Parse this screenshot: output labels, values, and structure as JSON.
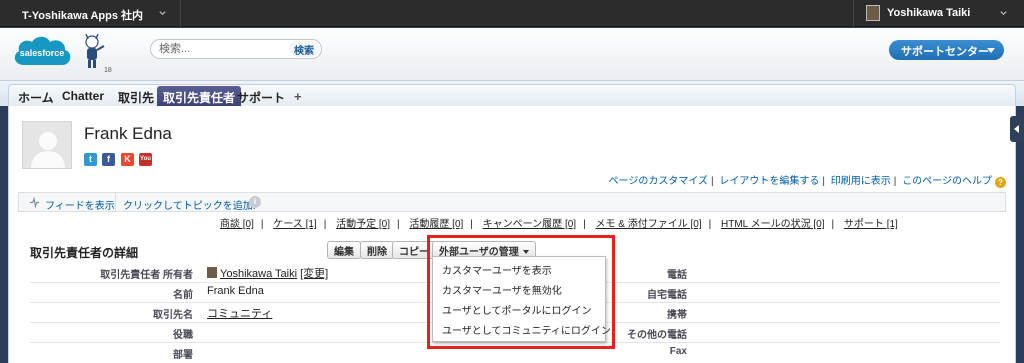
{
  "topbar": {
    "app_name": "T-Yoshikawa Apps 社内",
    "user_name": "Yoshikawa Taiki"
  },
  "header": {
    "logo_text": "salesforce",
    "mascot_badge": "18",
    "search_placeholder": "検索...",
    "search_button": "検索",
    "support_button": "サポートセンター"
  },
  "tabs": [
    {
      "label": "ホーム"
    },
    {
      "label": "Chatter"
    },
    {
      "label": "取引先"
    },
    {
      "label": "取引先責任者",
      "active": true
    },
    {
      "label": "サポート"
    }
  ],
  "tab_add": "+",
  "contact": {
    "name": "Frank Edna"
  },
  "social_icons": [
    {
      "icon": "twitter-icon",
      "glyph": "t",
      "color": "#2d9ad7"
    },
    {
      "icon": "facebook-icon",
      "glyph": "f",
      "color": "#3b5a9a"
    },
    {
      "icon": "klout-icon",
      "glyph": "K",
      "color": "#e54a2f"
    },
    {
      "icon": "youtube-icon",
      "glyph": "You",
      "color": "#c4302b"
    }
  ],
  "page_links": [
    "ページのカスタマイズ",
    "レイアウトを編集する",
    "印刷用に表示",
    "このページのヘルプ"
  ],
  "feed": {
    "show_feed": "フィードを表示",
    "add_topic": "クリックしてトピックを追加:"
  },
  "related_lists": [
    "商談 [0]",
    "ケース [1]",
    "活動予定 [0]",
    "活動履歴 [0]",
    "キャンペーン履歴 [0]",
    "メモ & 添付ファイル [0]",
    "HTML メールの状況 [0]",
    "サポート [1]"
  ],
  "detail": {
    "title": "取引先責任者の詳細",
    "buttons": {
      "edit": "編集",
      "delete": "削除",
      "copy": "コピー",
      "external_user": "外部ユーザの管理"
    },
    "fields_left": [
      {
        "label": "取引先責任者 所有者",
        "value": "Yoshikawa Taiki",
        "link": "[変更]"
      },
      {
        "label": "名前",
        "value": "Frank Edna"
      },
      {
        "label": "取引先名",
        "value": "コミュニティ"
      },
      {
        "label": "役職",
        "value": ""
      },
      {
        "label": "部署",
        "value": ""
      }
    ],
    "fields_right": [
      "電話",
      "自宅電話",
      "携帯",
      "その他の電話",
      "Fax"
    ]
  },
  "dropdown_menu": [
    "カスタマーユーザを表示",
    "カスタマーユーザを無効化",
    "ユーザとしてポータルにログイン",
    "ユーザとしてコミュニティにログイン"
  ]
}
